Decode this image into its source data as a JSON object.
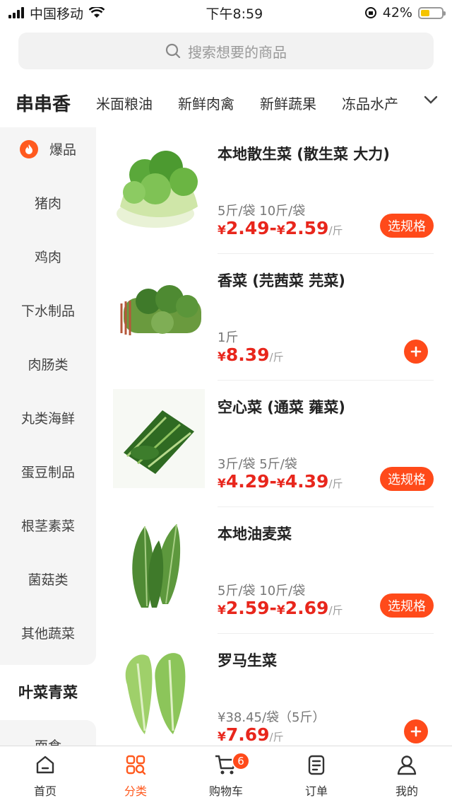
{
  "status_bar": {
    "carrier": "中国移动",
    "time": "下午8:59",
    "battery": "42%",
    "battery_level": 0.42
  },
  "search": {
    "placeholder": "搜索想要的商品"
  },
  "category_tabs": [
    {
      "label": "串串香",
      "active": true
    },
    {
      "label": "米面粮油"
    },
    {
      "label": "新鲜肉禽"
    },
    {
      "label": "新鲜蔬果"
    },
    {
      "label": "冻品水产"
    }
  ],
  "sidebar": {
    "items": [
      {
        "label": "爆品",
        "hot": true
      },
      {
        "label": "猪肉"
      },
      {
        "label": "鸡肉"
      },
      {
        "label": "下水制品"
      },
      {
        "label": "肉肠类"
      },
      {
        "label": "丸类海鲜"
      },
      {
        "label": "蛋豆制品"
      },
      {
        "label": "根茎素菜"
      },
      {
        "label": "菌菇类"
      },
      {
        "label": "其他蔬菜"
      },
      {
        "label": "叶菜青菜",
        "active": true
      },
      {
        "label": "面食"
      }
    ]
  },
  "products": [
    {
      "name": "本地散生菜 (散生菜 大力)",
      "spec": "5斤/袋 10斤/袋",
      "price_low": "2.49",
      "price_high": "2.59",
      "currency": "¥",
      "unit": "/斤",
      "action": "选规格"
    },
    {
      "name": "香菜 (芫茜菜 芫菜)",
      "spec": "1斤",
      "price_low": "8.39",
      "currency": "¥",
      "unit": "/斤",
      "action": "plus"
    },
    {
      "name": "空心菜 (通菜 蕹菜)",
      "spec": "3斤/袋 5斤/袋",
      "price_low": "4.29",
      "price_high": "4.39",
      "currency": "¥",
      "unit": "/斤",
      "action": "选规格"
    },
    {
      "name": "本地油麦菜",
      "spec": "5斤/袋 10斤/袋",
      "price_low": "2.59",
      "price_high": "2.69",
      "currency": "¥",
      "unit": "/斤",
      "action": "选规格"
    },
    {
      "name": "罗马生菜",
      "spec": "¥38.45/袋（5斤）",
      "price_low": "7.69",
      "currency": "¥",
      "unit": "/斤",
      "action": "plus"
    }
  ],
  "bottom_nav": [
    {
      "label": "首页",
      "icon": "home-icon"
    },
    {
      "label": "分类",
      "icon": "category-icon",
      "active": true
    },
    {
      "label": "购物车",
      "icon": "cart-icon",
      "badge": "6"
    },
    {
      "label": "订单",
      "icon": "order-icon"
    },
    {
      "label": "我的",
      "icon": "profile-icon"
    }
  ],
  "colors": {
    "accent": "#ff5a1f",
    "price": "#e8261c",
    "button": "#ff4a1a"
  }
}
